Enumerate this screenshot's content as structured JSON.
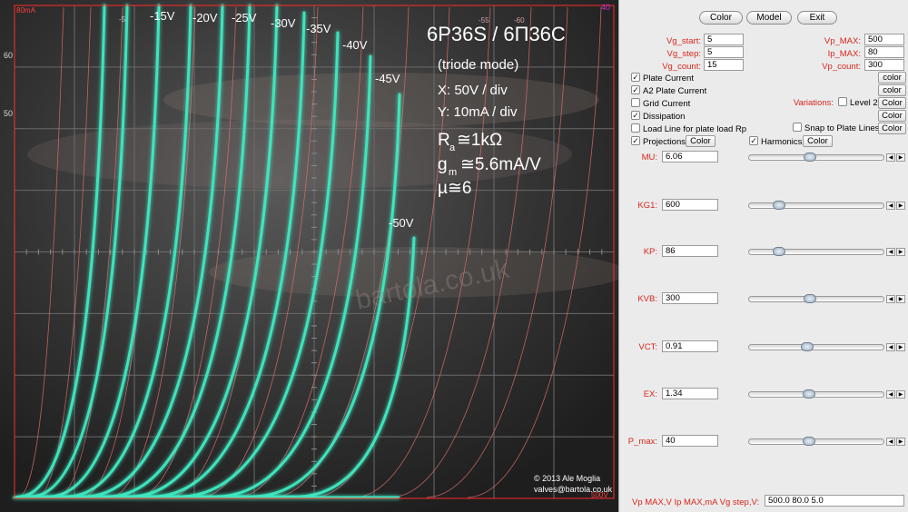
{
  "plot": {
    "title": "6P36S / 6П36С",
    "mode": "(triode mode)",
    "x_scale": "X: 50V / div",
    "y_scale": "Y: 10mA / div",
    "ra_main": "R",
    "ra_sub": "a",
    "ra_val": "≅1kΩ",
    "gm_main": "g",
    "gm_sub": "m",
    "gm_val": "≅5.6mA/V",
    "mu": "µ≅6",
    "copyright": "© 2013 Ale Moglia",
    "email": "valves@bartola.co.uk",
    "watermark": "bartola.co.uk",
    "corner_top_left": "80mA",
    "corner_top_right": "40",
    "corner_bottom_right": "500V",
    "axis_left_labels": [
      "60",
      "50"
    ],
    "tick_top_labels": [
      "-5",
      "-55",
      "-60"
    ],
    "curve_labels": [
      "-15V",
      "-20V",
      "-25V",
      "-30V",
      "-35V",
      "-40V",
      "-45V",
      "-50V"
    ],
    "colors": {
      "curve": "#3ee8c0",
      "grid": "#6a6a6a",
      "model": "#e07070",
      "frame": "#ff2a2a"
    }
  },
  "panel": {
    "buttons": {
      "color": "Color",
      "model": "Model",
      "exit": "Exit"
    },
    "params": {
      "vg_start_label": "Vg_start:",
      "vg_start": "5",
      "vg_step_label": "Vg_step:",
      "vg_step": "5",
      "vg_count_label": "Vg_count:",
      "vg_count": "15",
      "vp_max_label": "Vp_MAX:",
      "vp_max": "500",
      "ip_max_label": "Ip_MAX:",
      "ip_max": "80",
      "vp_count_label": "Vp_count:",
      "vp_count": "300"
    },
    "options": {
      "plate_current": "Plate Current",
      "a2_plate_current": "A2 Plate Current",
      "grid_current": "Grid Current",
      "dissipation": "Dissipation",
      "load_line": "Load Line for plate load Rp",
      "projections": "Projections",
      "harmonics": "Harmonics",
      "variations": "Variations:",
      "level2": "Level 2",
      "snap": "Snap to Plate Lines",
      "color_btn": "color",
      "Color_btn": "Color"
    },
    "model_params": [
      {
        "name": "MU:",
        "value": "6.06",
        "pos": 0.45
      },
      {
        "name": "KG1:",
        "value": "600",
        "pos": 0.2
      },
      {
        "name": "KP:",
        "value": "86",
        "pos": 0.2
      },
      {
        "name": "KVB:",
        "value": "300",
        "pos": 0.45
      },
      {
        "name": "VCT:",
        "value": "0.91",
        "pos": 0.43
      },
      {
        "name": "EX:",
        "value": "1.34",
        "pos": 0.44
      },
      {
        "name": "P_max:",
        "value": "40",
        "pos": 0.44
      }
    ],
    "bottom_label": "Vp MAX,V Ip MAX,mA Vg step,V:",
    "bottom_value": "500.0 80.0 5.0"
  }
}
